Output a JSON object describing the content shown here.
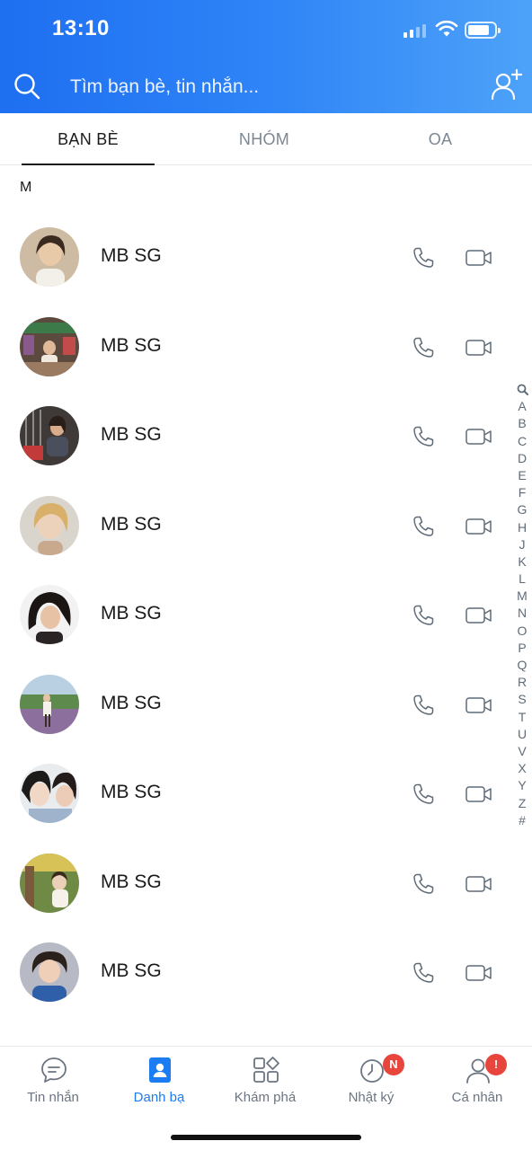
{
  "status_bar": {
    "time": "13:10"
  },
  "search": {
    "placeholder": "Tìm bạn bè, tin nhắn..."
  },
  "tabs": [
    {
      "label": "BẠN BÈ",
      "active": true
    },
    {
      "label": "NHÓM",
      "active": false
    },
    {
      "label": "OA",
      "active": false
    }
  ],
  "section_letter": "M",
  "contacts": [
    {
      "name": "MB SG"
    },
    {
      "name": "MB SG"
    },
    {
      "name": "MB SG"
    },
    {
      "name": "MB SG"
    },
    {
      "name": "MB SG"
    },
    {
      "name": "MB SG"
    },
    {
      "name": "MB SG"
    },
    {
      "name": "MB SG"
    },
    {
      "name": "MB SG"
    }
  ],
  "alphabet_index": [
    "A",
    "B",
    "C",
    "D",
    "E",
    "F",
    "G",
    "H",
    "J",
    "K",
    "L",
    "M",
    "N",
    "O",
    "P",
    "Q",
    "R",
    "S",
    "T",
    "U",
    "V",
    "X",
    "Y",
    "Z",
    "#"
  ],
  "bottom_nav": [
    {
      "label": "Tin nhắn",
      "icon": "chat-icon",
      "active": false
    },
    {
      "label": "Danh bạ",
      "icon": "contacts-icon",
      "active": true
    },
    {
      "label": "Khám phá",
      "icon": "discover-icon",
      "active": false
    },
    {
      "label": "Nhật ký",
      "icon": "timeline-icon",
      "active": false,
      "badge": "N"
    },
    {
      "label": "Cá nhân",
      "icon": "profile-icon",
      "active": false,
      "badge": "!"
    }
  ],
  "colors": {
    "header_blue": "#1e6ff1",
    "accent": "#1c7cf2",
    "badge_red": "#e8453c"
  }
}
